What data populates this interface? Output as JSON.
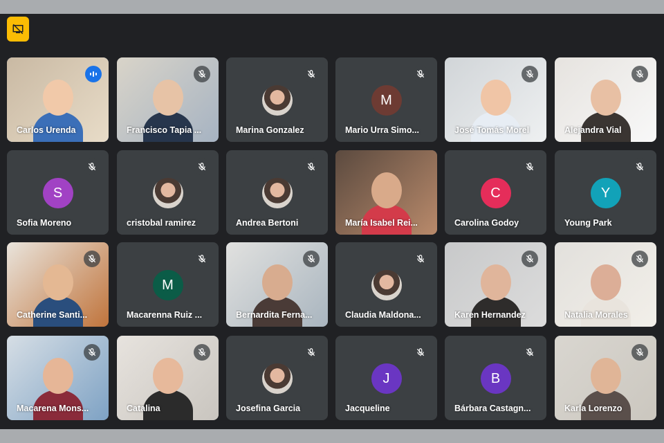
{
  "colors": {
    "background": "#202124",
    "tile": "#3c4043",
    "speaking_accent": "#1a73e8",
    "status_button": "#fbbc04"
  },
  "status_button": {
    "icon": "no-presentation-icon"
  },
  "participants": [
    {
      "name": "Carlos Urenda",
      "type": "video",
      "speaking": true,
      "muted": false
    },
    {
      "name": "Francisco Tapia ...",
      "type": "video",
      "muted": true
    },
    {
      "name": "Marina Gonzalez",
      "type": "photo",
      "muted": true
    },
    {
      "name": "Mario Urra Simo...",
      "type": "letter",
      "letter": "M",
      "avatar_color": "#6d3b33",
      "muted": true
    },
    {
      "name": "José Tomás Morel",
      "type": "video",
      "muted": true
    },
    {
      "name": "Alejandra Vial",
      "type": "video",
      "muted": true
    },
    {
      "name": "Sofia Moreno",
      "type": "letter",
      "letter": "S",
      "avatar_color": "#a142c4",
      "muted": true
    },
    {
      "name": "cristobal ramirez",
      "type": "photo",
      "muted": true
    },
    {
      "name": "Andrea Bertoni",
      "type": "photo",
      "muted": true
    },
    {
      "name": "María Isabel Rei...",
      "type": "video",
      "muted": false
    },
    {
      "name": "Carolina Godoy",
      "type": "letter",
      "letter": "C",
      "avatar_color": "#e52d5a",
      "muted": true
    },
    {
      "name": "Young Park",
      "type": "letter",
      "letter": "Y",
      "avatar_color": "#12a2b8",
      "muted": true
    },
    {
      "name": "Catherine Santi...",
      "type": "video",
      "muted": true
    },
    {
      "name": "Macarenna Ruiz ...",
      "type": "letter",
      "letter": "M",
      "avatar_color": "#0b5c47",
      "muted": true
    },
    {
      "name": "Bernardita Ferna...",
      "type": "video",
      "muted": true
    },
    {
      "name": "Claudia Maldona...",
      "type": "photo",
      "muted": true
    },
    {
      "name": "Karen Hernandez",
      "type": "video",
      "muted": true
    },
    {
      "name": "Natalia Morales",
      "type": "video",
      "muted": true
    },
    {
      "name": "Macarena Mons...",
      "type": "video",
      "muted": true
    },
    {
      "name": "Catalina",
      "type": "video",
      "muted": true
    },
    {
      "name": "Josefina Garcia",
      "type": "photo",
      "muted": true
    },
    {
      "name": "Jacqueline",
      "type": "letter",
      "letter": "J",
      "avatar_color": "#6a36c2",
      "muted": true
    },
    {
      "name": "Bárbara Castagn...",
      "type": "letter",
      "letter": "B",
      "avatar_color": "#6a36c2",
      "muted": true
    },
    {
      "name": "Karla Lorenzo",
      "type": "video",
      "muted": true
    }
  ]
}
